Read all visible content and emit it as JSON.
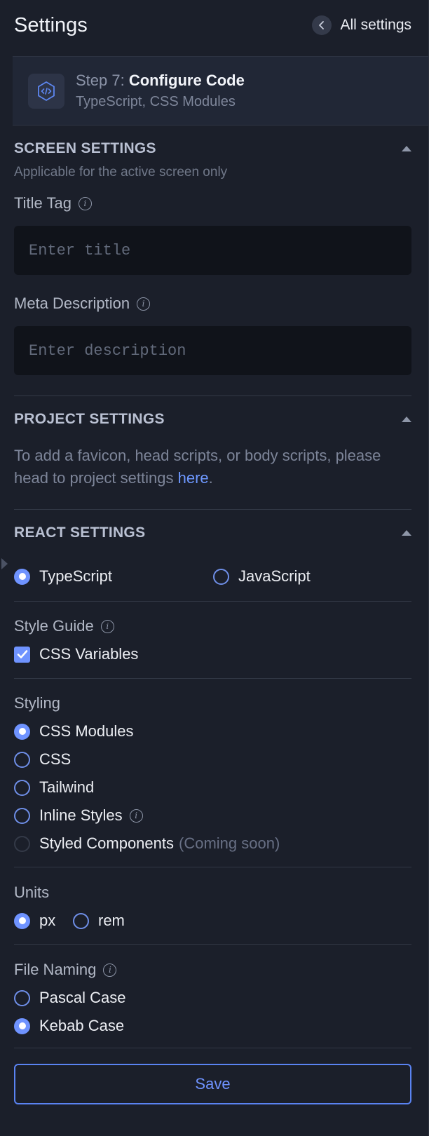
{
  "header": {
    "title": "Settings",
    "back_label": "All settings"
  },
  "step": {
    "prefix": "Step 7:",
    "name": "Configure Code",
    "summary": "TypeScript, CSS Modules"
  },
  "screen_settings": {
    "title": "SCREEN SETTINGS",
    "subtitle": "Applicable for the active screen only",
    "title_tag_label": "Title Tag",
    "title_placeholder": "Enter title",
    "title_value": "",
    "meta_label": "Meta Description",
    "meta_placeholder": "Enter description",
    "meta_value": ""
  },
  "project_settings": {
    "title": "PROJECT SETTINGS",
    "text": "To add a favicon, head scripts, or body scripts, please head to project settings ",
    "link": "here",
    "period": "."
  },
  "react_settings": {
    "title": "REACT SETTINGS",
    "language": {
      "options": [
        "TypeScript",
        "JavaScript"
      ],
      "selected": "TypeScript"
    },
    "style_guide": {
      "label": "Style Guide",
      "css_variables_label": "CSS Variables",
      "css_variables_checked": true
    },
    "styling": {
      "label": "Styling",
      "options": [
        "CSS Modules",
        "CSS",
        "Tailwind",
        "Inline Styles",
        "Styled Components"
      ],
      "selected": "CSS Modules",
      "coming_soon": "(Coming soon)"
    },
    "units": {
      "label": "Units",
      "options": [
        "px",
        "rem"
      ],
      "selected": "px"
    },
    "file_naming": {
      "label": "File Naming",
      "options": [
        "Pascal Case",
        "Kebab Case"
      ],
      "selected": "Kebab Case"
    }
  },
  "save_label": "Save",
  "colors": {
    "accent": "#6f93ff",
    "background": "#1b1f2a",
    "input_bg": "#10131a"
  },
  "icons": {
    "back": "chevron-left-icon",
    "step": "code-icon",
    "info": "info-icon",
    "collapse": "caret-up-icon"
  }
}
